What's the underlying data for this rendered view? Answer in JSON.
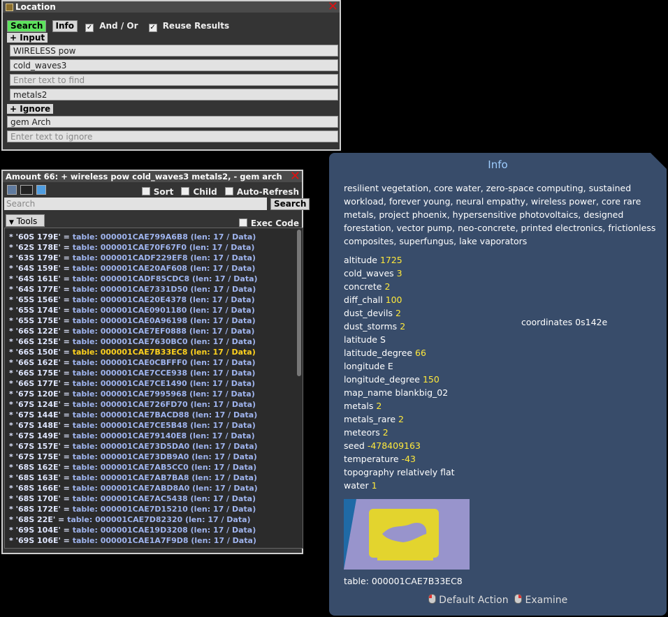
{
  "location": {
    "title": "Location",
    "search_label": "Search",
    "info_label": "Info",
    "andor_label": "And / Or",
    "reuse_label": "Reuse Results",
    "input_section": "+ Input",
    "inputs": [
      "WIRELESS pow",
      "cold_waves3",
      "",
      "metals2"
    ],
    "input_placeholder": "Enter text to find",
    "ignore_section": "+ Ignore",
    "ignores": [
      "gem Arch",
      ""
    ],
    "ignore_placeholder": "Enter text to ignore"
  },
  "results": {
    "title": "Amount  66: + wireless  pow cold_waves3 metals2, - gem arch",
    "sort_label": "Sort",
    "child_label": "Child",
    "autorefresh_label": "Auto-Refresh",
    "search_placeholder": "Search",
    "search_button": "Search",
    "tools_label": "Tools",
    "exec_code_label": "Exec Code",
    "rows": [
      {
        "key": "* '60S 179E' = ",
        "value": "table: 000001CAE799A6B8  (len: 17 / Data)"
      },
      {
        "key": "* '62S 178E' = ",
        "value": "table: 000001CAE70F67F0  (len: 17 / Data)"
      },
      {
        "key": "* '63S 179E' = ",
        "value": "table: 000001CADF229EF8  (len: 17 / Data)"
      },
      {
        "key": "* '64S 159E' = ",
        "value": "table: 000001CAE20AF608  (len: 17 / Data)"
      },
      {
        "key": "* '64S 161E' = ",
        "value": "table: 000001CADF85CDC8  (len: 17 / Data)"
      },
      {
        "key": "* '64S 177E' = ",
        "value": "table: 000001CAE7331D50  (len: 17 / Data)"
      },
      {
        "key": "* '65S 156E' = ",
        "value": "table: 000001CAE20E4378  (len: 17 / Data)"
      },
      {
        "key": "* '65S 174E' = ",
        "value": "table: 000001CAE0901180  (len: 17 / Data)"
      },
      {
        "key": "* '65S 175E' = ",
        "value": "table: 000001CAE0A96198  (len: 17 / Data)"
      },
      {
        "key": "* '66S 122E' = ",
        "value": "table: 000001CAE7EF0888  (len: 17 / Data)"
      },
      {
        "key": "* '66S 125E' = ",
        "value": "table: 000001CAE7630BC0  (len: 17 / Data)"
      },
      {
        "key": "* '66S 150E' = ",
        "value": "table: 000001CAE7B33EC8  (len: 17 / Data)",
        "selected": true
      },
      {
        "key": "* '66S 162E' = ",
        "value": "table: 000001CAE0CBFFF0  (len: 17 / Data)"
      },
      {
        "key": "* '66S 175E' = ",
        "value": "table: 000001CAE7CCE938  (len: 17 / Data)"
      },
      {
        "key": "* '66S 177E' = ",
        "value": "table: 000001CAE7CE1490  (len: 17 / Data)"
      },
      {
        "key": "* '67S 120E' = ",
        "value": "table: 000001CAE7995968  (len: 17 / Data)"
      },
      {
        "key": "* '67S 124E' = ",
        "value": "table: 000001CAE726FD70  (len: 17 / Data)"
      },
      {
        "key": "* '67S 144E' = ",
        "value": "table: 000001CAE7BACD88  (len: 17 / Data)"
      },
      {
        "key": "* '67S 148E' = ",
        "value": "table: 000001CAE7CE5B48  (len: 17 / Data)"
      },
      {
        "key": "* '67S 149E' = ",
        "value": "table: 000001CAE79140E8  (len: 17 / Data)"
      },
      {
        "key": "* '67S 157E' = ",
        "value": "table: 000001CAE73D5DA0  (len: 17 / Data)"
      },
      {
        "key": "* '67S 175E' = ",
        "value": "table: 000001CAE73DB9A0  (len: 17 / Data)"
      },
      {
        "key": "* '68S 162E' = ",
        "value": "table: 000001CAE7AB5CC0  (len: 17 / Data)"
      },
      {
        "key": "* '68S 163E' = ",
        "value": "table: 000001CAE7AB7BA8  (len: 17 / Data)"
      },
      {
        "key": "* '68S 166E' = ",
        "value": "table: 000001CAE7ABD8A0  (len: 17 / Data)"
      },
      {
        "key": "* '68S 170E' = ",
        "value": "table: 000001CAE7AC5438  (len: 17 / Data)"
      },
      {
        "key": "* '68S 172E' = ",
        "value": "table: 000001CAE7D15210  (len: 17 / Data)"
      },
      {
        "key": "* '68S 22E' = ",
        "value": "table: 000001CAE7D82320  (len: 17 / Data)"
      },
      {
        "key": "* '69S 104E' = ",
        "value": "table: 000001CAE19D3208  (len: 17 / Data)"
      },
      {
        "key": "* '69S 106E' = ",
        "value": "table: 000001CAE1A7F9D8  (len: 17 / Data)"
      }
    ]
  },
  "info": {
    "title": "Info",
    "description": "resilient vegetation, core water, zero-space computing, sustained workload, forever young, neural empathy, wireless power, core rare metals, project phoenix, hypersensitive photovoltaics, designed forestation, vector pump, neo-concrete, printed electronics, frictionless composites, superfungus, lake vaporators",
    "fields": [
      {
        "key": "altitude",
        "value": "1725"
      },
      {
        "key": "cold_waves",
        "value": "3"
      },
      {
        "key": "concrete",
        "value": "2"
      },
      {
        "key": "diff_chall",
        "value": "100"
      },
      {
        "key": "dust_devils",
        "value": "2"
      },
      {
        "key": "dust_storms",
        "value": "2"
      },
      {
        "key": "latitude",
        "value": "S",
        "plain": true
      },
      {
        "key": "latitude_degree",
        "value": "66"
      },
      {
        "key": "longitude",
        "value": "E",
        "plain": true
      },
      {
        "key": "longitude_degree",
        "value": "150"
      },
      {
        "key": "map_name",
        "value": "blankbig_02",
        "plain": true
      },
      {
        "key": "metals",
        "value": "2"
      },
      {
        "key": "metals_rare",
        "value": "2"
      },
      {
        "key": "meteors",
        "value": "2"
      },
      {
        "key": "seed",
        "value": "-478409163"
      },
      {
        "key": "temperature",
        "value": "-43"
      },
      {
        "key": "topography",
        "value": "relatively flat",
        "plain": true
      },
      {
        "key": "water",
        "value": "1"
      }
    ],
    "coordinates": "coordinates 0s142e",
    "table_ref": "table: 000001CAE7B33EC8",
    "default_action": "Default Action",
    "examine": "Examine"
  }
}
